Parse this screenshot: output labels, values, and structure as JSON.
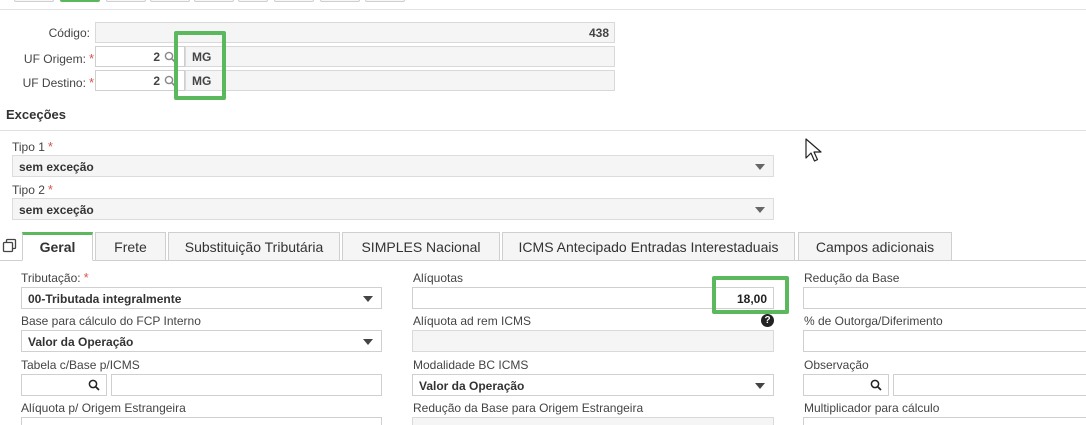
{
  "header": {
    "codigo_label": "Código:",
    "codigo_value": "438",
    "uf_origem_label": "UF Origem:",
    "uf_origem_code": "2",
    "uf_origem_sigla": "MG",
    "uf_destino_label": "UF Destino:",
    "uf_destino_code": "2",
    "uf_destino_sigla": "MG",
    "required_mark": "*"
  },
  "excecoes": {
    "title": "Exceções",
    "tipo1_label": "Tipo 1",
    "tipo1_value": "sem exceção",
    "tipo2_label": "Tipo 2",
    "tipo2_value": "sem exceção"
  },
  "tabs": [
    {
      "label": "Geral"
    },
    {
      "label": "Frete"
    },
    {
      "label": "Substituição Tributária"
    },
    {
      "label": "SIMPLES Nacional"
    },
    {
      "label": "ICMS Antecipado Entradas Interestaduais"
    },
    {
      "label": "Campos adicionais"
    }
  ],
  "geral": {
    "tributacao_label": "Tributação:",
    "tributacao_value": "00-Tributada integralmente",
    "base_fcp_label": "Base para cálculo do FCP Interno",
    "base_fcp_value": "Valor da Operação",
    "tabela_base_label": "Tabela c/Base p/ICMS",
    "aliquota_origem_label": "Alíquota p/ Origem Estrangeira",
    "aliquotas_label": "Alíquotas",
    "aliquotas_value": "18,00",
    "aliquota_adrem_label": "Alíquota ad rem ICMS",
    "help_glyph": "?",
    "modalidade_label": "Modalidade BC ICMS",
    "modalidade_value": "Valor da Operação",
    "reducao_origem_label": "Redução da Base para Origem Estrangeira",
    "reducao_base_label": "Redução da Base",
    "outorga_label": "% de Outorga/Diferimento",
    "observacao_label": "Observação",
    "multiplicador_label": "Multiplicador para cálculo"
  },
  "colors": {
    "highlight": "#5cb85c",
    "required": "#d9534f"
  }
}
